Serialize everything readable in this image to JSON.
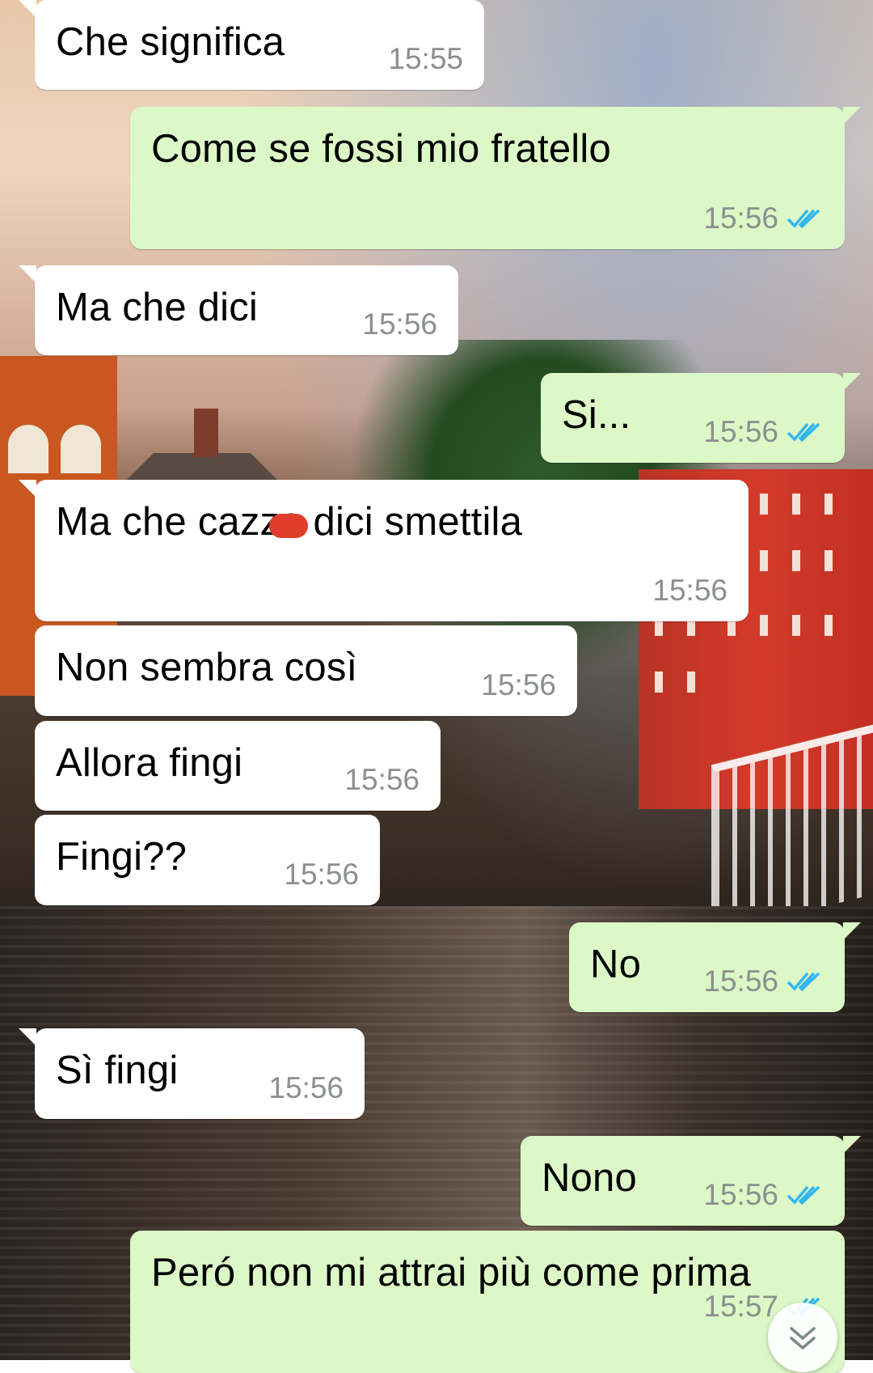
{
  "wallpaper": {
    "description_icon": "city-river-wallpaper"
  },
  "colors": {
    "incoming": "#ffffff",
    "outgoing": "#dcf8c6",
    "read_ticks": "#34b7f1",
    "timestamp": "#8b8f8f",
    "censor_mark": "#e03c2b"
  },
  "messages": [
    {
      "direction": "in",
      "text": "Che significa",
      "time": "15:55"
    },
    {
      "direction": "out",
      "text": "Come se fossi mio fratello",
      "time": "15:56",
      "status": "read"
    },
    {
      "direction": "in",
      "text": "Ma che dici",
      "time": "15:56"
    },
    {
      "direction": "out",
      "text": "Si...",
      "time": "15:56",
      "status": "read"
    },
    {
      "direction": "in",
      "text": "Ma che cazzo dici smettila",
      "time": "15:56",
      "note_icon": "red-censor-mark"
    },
    {
      "direction": "in",
      "text": "Non sembra così",
      "time": "15:56"
    },
    {
      "direction": "in",
      "text": "Allora fingi",
      "time": "15:56"
    },
    {
      "direction": "in",
      "text": "Fingi??",
      "time": "15:56"
    },
    {
      "direction": "out",
      "text": "No",
      "time": "15:56",
      "status": "read"
    },
    {
      "direction": "in",
      "text": "Sì fingi",
      "time": "15:56"
    },
    {
      "direction": "out",
      "text": "Nono",
      "time": "15:56",
      "status": "read"
    },
    {
      "direction": "out",
      "text": "Peró non mi attrai più come prima",
      "time": "15:57",
      "status": "read"
    }
  ],
  "scroll_button_icon": "chevron-double-down-icon"
}
